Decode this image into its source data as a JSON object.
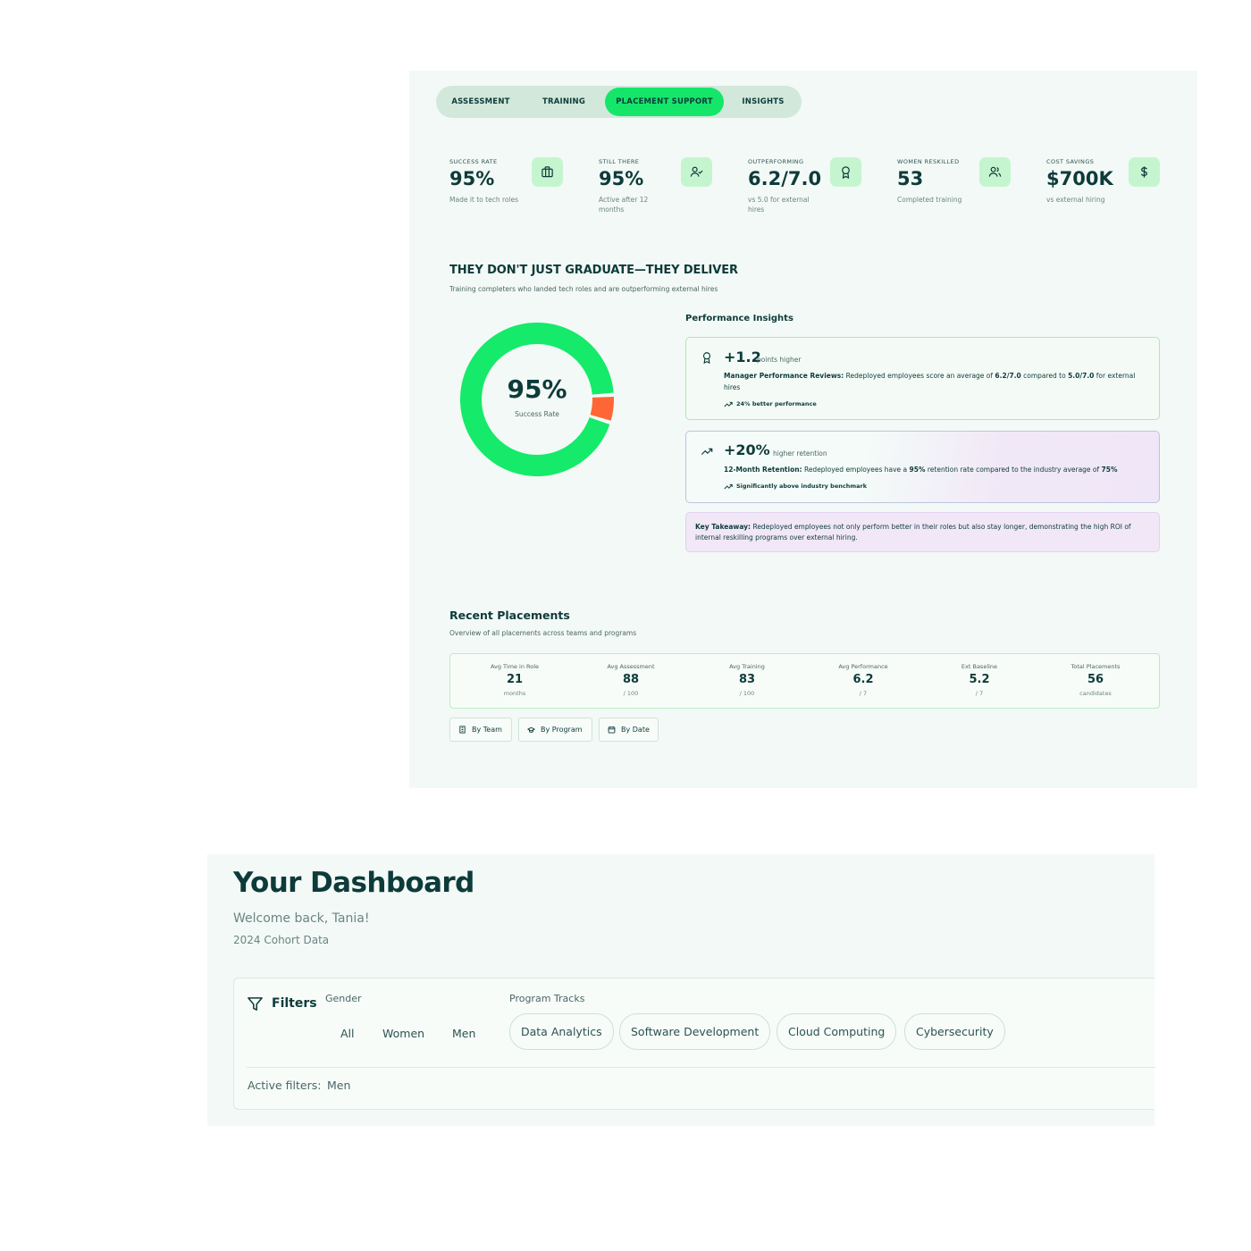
{
  "tabs": [
    {
      "label": "ASSESSMENT",
      "active": false
    },
    {
      "label": "TRAINING",
      "active": false
    },
    {
      "label": "PLACEMENT SUPPORT",
      "active": true
    },
    {
      "label": "INSIGHTS",
      "active": false
    }
  ],
  "stats": [
    {
      "label": "SUCCESS RATE",
      "value": "95%",
      "sub": "Made it to tech roles",
      "icon": "briefcase-icon"
    },
    {
      "label": "STILL THERE",
      "value": "95%",
      "sub": "Active after 12 months",
      "icon": "user-check-icon"
    },
    {
      "label": "OUTPERFORMING",
      "value": "6.2/7.0",
      "sub": "vs 5.0 for external hires",
      "icon": "award-icon"
    },
    {
      "label": "WOMEN RESKILLED",
      "value": "53",
      "sub": "Completed training",
      "icon": "users-icon"
    },
    {
      "label": "COST SAVINGS",
      "value": "$700K",
      "sub": "vs external hiring",
      "icon": "dollar-icon"
    }
  ],
  "section": {
    "title": "THEY DON'T JUST GRADUATE—THEY DELIVER",
    "subtitle": "Training completers who landed tech roles and are outperforming external hires"
  },
  "donut": {
    "value": "95%",
    "label": "Success Rate",
    "fraction": 0.95,
    "colors": {
      "primary": "#15ea6a",
      "remainder": "#ff6635"
    }
  },
  "insights": {
    "title": "Performance Insights",
    "performance": {
      "big": "+1.2",
      "small": "points higher",
      "heading": "Manager Performance Reviews:",
      "text_a": " Redeployed employees score an average of ",
      "value_a": "6.2/7.0",
      "text_b": " compared to ",
      "value_b": "5.0/7.0",
      "text_c": " for external hires",
      "note": "24% better performance"
    },
    "retention": {
      "big": "+20%",
      "small": "higher retention",
      "heading": "12-Month Retention:",
      "text_a": " Redeployed employees have a ",
      "value_a": "95%",
      "text_b": " retention rate compared to the industry average of ",
      "value_b": "75%",
      "note": "Significantly above industry benchmark"
    },
    "takeaway": {
      "heading": "Key Takeaway:",
      "text": " Redeployed employees not only perform better in their roles but also stay longer, demonstrating the high ROI of internal reskilling programs over external hiring."
    }
  },
  "placements": {
    "title": "Recent Placements",
    "subtitle": "Overview of all placements across teams and programs",
    "metrics": [
      {
        "label": "Avg Time in Role",
        "value": "21",
        "unit": "months"
      },
      {
        "label": "Avg Assessment",
        "value": "88",
        "unit": "/ 100"
      },
      {
        "label": "Avg Training",
        "value": "83",
        "unit": "/ 100"
      },
      {
        "label": "Avg Performance",
        "value": "6.2",
        "unit": "/ 7"
      },
      {
        "label": "Ext Baseline",
        "value": "5.2",
        "unit": "/ 7"
      },
      {
        "label": "Total Placements",
        "value": "56",
        "unit": "candidates"
      }
    ],
    "group_buttons": [
      "By Team",
      "By Program",
      "By Date"
    ]
  },
  "dashboard": {
    "title": "Your Dashboard",
    "welcome": "Welcome back, Tania!",
    "cohort": "2024 Cohort Data"
  },
  "filters": {
    "label": "Filters",
    "gender_label": "Gender",
    "gender_options": [
      "All",
      "Women",
      "Men"
    ],
    "tracks_label": "Program Tracks",
    "tracks": [
      "Data Analytics",
      "Software Development",
      "Cloud Computing",
      "Cybersecurity"
    ],
    "active_label": "Active filters:",
    "active_value": "Men"
  }
}
